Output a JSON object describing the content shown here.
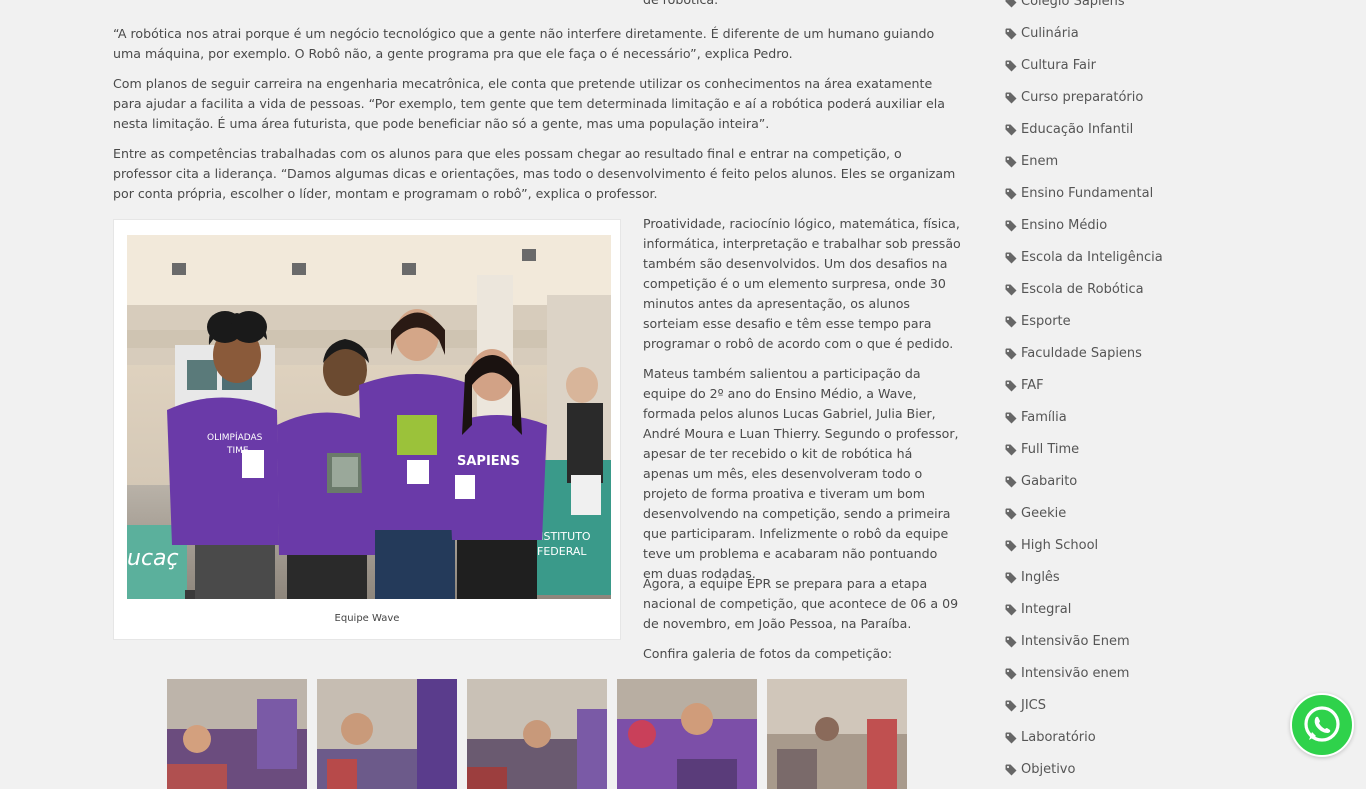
{
  "article": {
    "p0_tail": "de robótica.",
    "p1": "“A robótica nos atrai porque é um negócio tecnológico que a gente não interfere diretamente. É diferente de um humano guiando uma máquina, por exemplo. O Robô não, a gente programa pra que ele faça o é necessário”, explica Pedro.",
    "p2": "Com planos de seguir carreira na engenharia mecatrônica, ele conta que pretende utilizar os conhecimentos na área exatamente para ajudar a facilita a vida de pessoas. “Por exemplo, tem gente que tem determinada limitação e aí a robótica poderá auxiliar ela nesta limitação. É uma área futurista, que pode beneficiar não só a gente, mas uma população inteira”.",
    "p3": "Entre as competências trabalhadas com os alunos para que eles possam chegar ao resultado final e entrar na competição, o professor cita a liderança. “Damos algumas dicas e orientações, mas todo o desenvolvimento é feito pelos alunos. Eles se organizam por conta própria, escolher o líder, montam e programam o robô”, explica o professor.",
    "figure_caption": "Equipe Wave",
    "p4": "Proatividade, raciocínio lógico, matemática, física, informática, interpretação e trabalhar sob pressão também são desenvolvidos. Um dos desafios na competição é o um elemento surpresa, onde 30 minutos antes da apresentação, os alunos sorteiam esse desafio e têm esse tempo para programar o robô de acordo com o que é pedido.",
    "p5": "Mateus também salientou a participação da equipe do 2º ano do Ensino Médio, a Wave, formada pelos alunos Lucas Gabriel, Julia Bier, André Moura e Luan Thierry. Segundo o professor, apesar de ter recebido o kit de robótica há apenas um mês, eles desenvolveram todo o projeto de forma proativa e tiveram um bom desenvolvendo na competição, sendo a primeira que participaram. Infelizmente o robô da equipe teve um problema e acabaram não pontuando em duas rodadas.",
    "p6": "Agora, a equipe EPR se prepara para a etapa nacional de competição, que acontece de 06 a 09 de novembro, em João Pessoa, na Paraíba.",
    "p7": "Confira galeria de fotos da competição:"
  },
  "photo": {
    "shirt_text_1": "OLIMPÍADAS",
    "shirt_text_2": "TIME",
    "shirt_text_3": "SAPIENS",
    "banner_text_1": "INSTITUTO",
    "banner_text_2": "FEDERAL",
    "banner_text_3": "ucaç"
  },
  "sidebar": {
    "tags": [
      "Colégio Sapiens",
      "Culinária",
      "Cultura Fair",
      "Curso preparatório",
      "Educação Infantil",
      "Enem",
      "Ensino Fundamental",
      "Ensino Médio",
      "Escola da Inteligência",
      "Escola de Robótica",
      "Esporte",
      "Faculdade Sapiens",
      "FAF",
      "Família",
      "Full Time",
      "Gabarito",
      "Geekie",
      "High School",
      "Inglês",
      "Integral",
      "Intensivão Enem",
      "Intensivão enem",
      "JICS",
      "Laboratório",
      "Objetivo"
    ]
  },
  "icons": {
    "tag": "tag-icon",
    "whatsapp": "whatsapp-icon"
  },
  "colors": {
    "text": "#4a4a4a",
    "background": "#f1f1f1",
    "whatsapp": "#2fd24b",
    "shirt": "#6a3aa8"
  }
}
